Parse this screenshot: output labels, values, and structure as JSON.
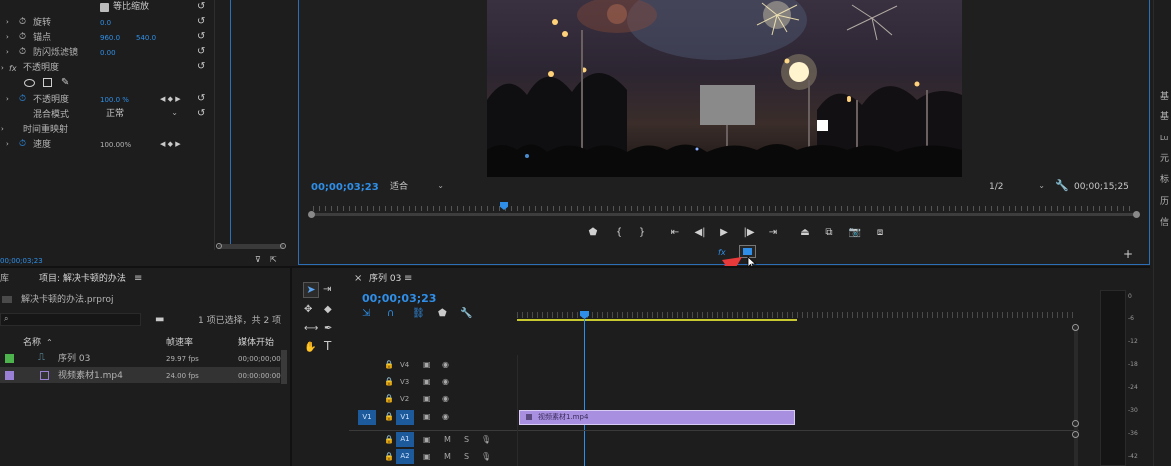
{
  "effect_controls": {
    "uniform_scale": "等比缩放",
    "rotation_label": "旋转",
    "rotation_value": "0.0",
    "anchor_label": "锚点",
    "anchor_x": "960.0",
    "anchor_y": "540.0",
    "antiflicker_label": "防闪烁滤镜",
    "antiflicker_value": "0.00",
    "opacity_section": "不透明度",
    "opacity_label": "不透明度",
    "opacity_value": "100.0 %",
    "blend_label": "混合模式",
    "blend_value": "正常",
    "time_remap_section": "时间重映射",
    "speed_label": "速度",
    "speed_value": "100.00%",
    "timecode": "00;00;03;23",
    "fx_symbol": "fx"
  },
  "program_monitor": {
    "timecode": "00;00;03;23",
    "fit_label": "适合",
    "resolution": "1/2",
    "duration": "00;00;15;25",
    "fx_label": "fx"
  },
  "project": {
    "tab_left": "库",
    "tab_title": "项目: 解决卡顿的办法",
    "file_name": "解决卡顿的办法.prproj",
    "selection_status": "1 项已选择，共 2 项",
    "col_name": "名称",
    "col_fps": "帧速率",
    "col_start": "媒体开始",
    "items": [
      {
        "name": "序列 03",
        "fps": "29.97 fps",
        "start": "00;00;00;00",
        "color": "#4db34d"
      },
      {
        "name": "视频素材1.mp4",
        "fps": "24.00 fps",
        "start": "00:00:00:00",
        "color": "#9a7fd6"
      }
    ]
  },
  "timeline": {
    "tab_title": "序列 03",
    "timecode": "00;00;03;23",
    "clip_name": "视频素材1.mp4",
    "tracks": [
      {
        "name": "V4"
      },
      {
        "name": "V3"
      },
      {
        "name": "V2"
      },
      {
        "name": "V1"
      },
      {
        "name": "A1"
      },
      {
        "name": "A2"
      }
    ],
    "source_v1": "V1",
    "mute": "M",
    "solo": "S"
  },
  "audio_meter": {
    "labels": [
      "0",
      "-6",
      "-12",
      "-18",
      "-24",
      "-30",
      "-36",
      "-42"
    ]
  },
  "right_panel": {
    "items": [
      "基",
      "基",
      "Lu",
      "元",
      "标",
      "历",
      "信",
      "字"
    ]
  },
  "colors": {
    "accent": "#2f8fe8",
    "clip": "#a88fe0",
    "arrow": "#e83a3a",
    "work_area": "#c8c830"
  }
}
